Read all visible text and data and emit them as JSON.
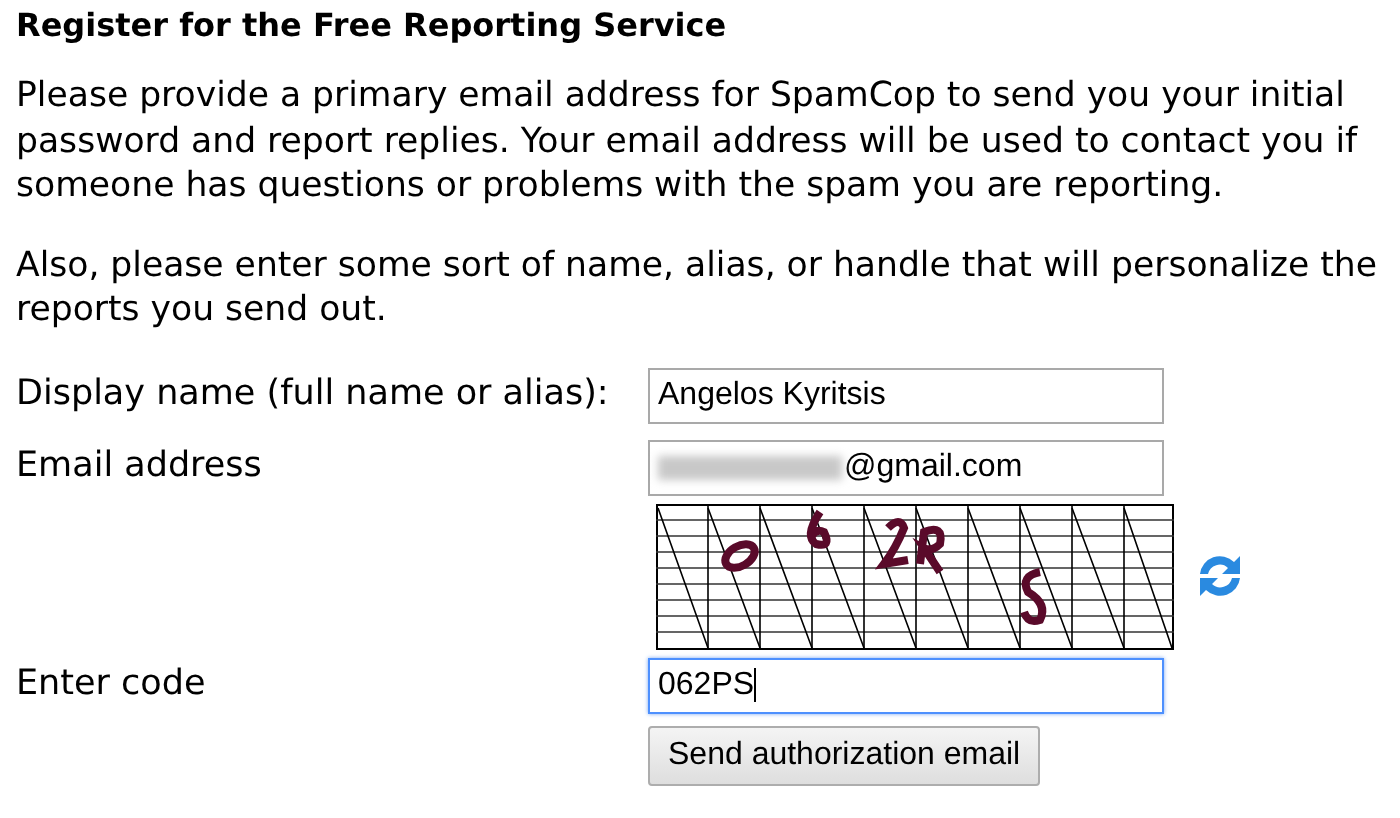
{
  "heading": "Register for the Free Reporting Service",
  "paragraphs": [
    "Please provide a primary email address for SpamCop to send you your initial password and report replies. Your email address will be used to contact you if someone has questions or problems with the spam you are reporting.",
    "Also, please enter some sort of name, alias, or handle that will personalize the reports you send out."
  ],
  "fields": [
    {
      "label": "Display name (full name or alias):",
      "value": "Angelos Kyritsis",
      "redacted": false,
      "focused": false
    },
    {
      "label": "Email address",
      "value": "@gmail.com",
      "redacted": true,
      "focused": false
    }
  ],
  "code_field": {
    "label": "Enter code",
    "value": "062PS",
    "focused": true
  },
  "submit_button": "Send authorization email"
}
